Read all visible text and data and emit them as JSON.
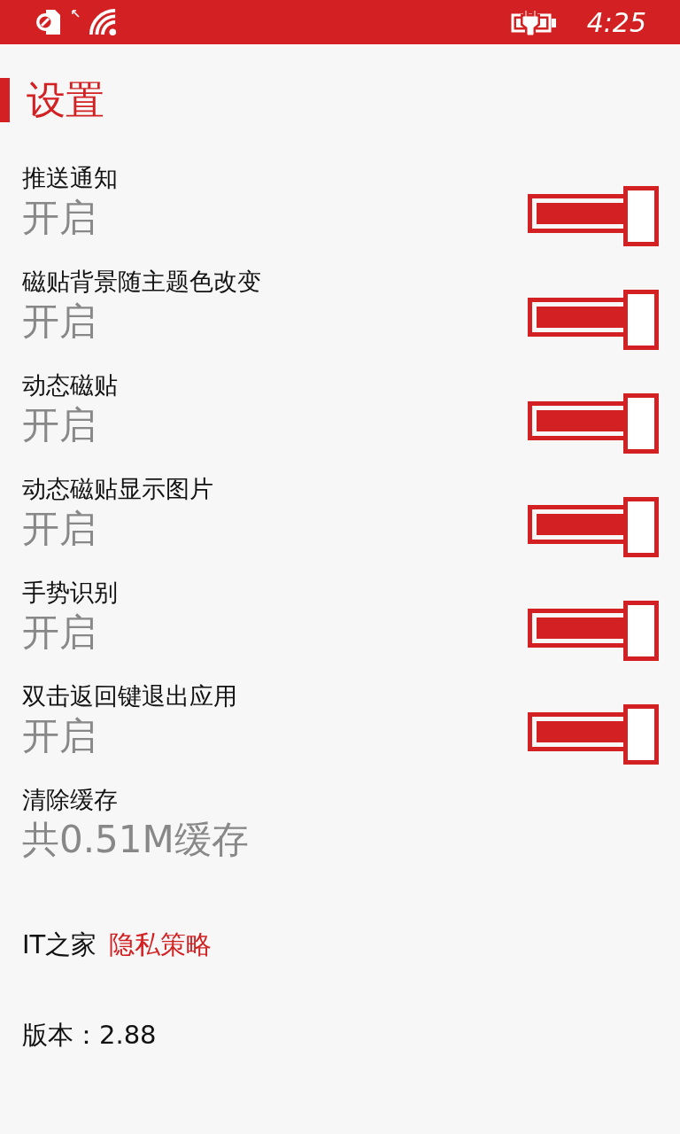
{
  "status_bar": {
    "time": "4:25"
  },
  "title": "设置",
  "settings": [
    {
      "kind": "toggle",
      "label": "推送通知",
      "value": "开启",
      "on": true
    },
    {
      "kind": "toggle",
      "label": "磁贴背景随主题色改变",
      "value": "开启",
      "on": true
    },
    {
      "kind": "toggle",
      "label": "动态磁贴",
      "value": "开启",
      "on": true
    },
    {
      "kind": "toggle",
      "label": "动态磁贴显示图片",
      "value": "开启",
      "on": true
    },
    {
      "kind": "toggle",
      "label": "手势识别",
      "value": "开启",
      "on": true
    },
    {
      "kind": "toggle",
      "label": "双击返回键退出应用",
      "value": "开启",
      "on": true
    },
    {
      "kind": "info",
      "label": "清除缓存",
      "value": "共0.51M缓存"
    }
  ],
  "about": {
    "brand": "IT之家",
    "privacy_link": "隐私策略",
    "version": "版本：2.88"
  }
}
